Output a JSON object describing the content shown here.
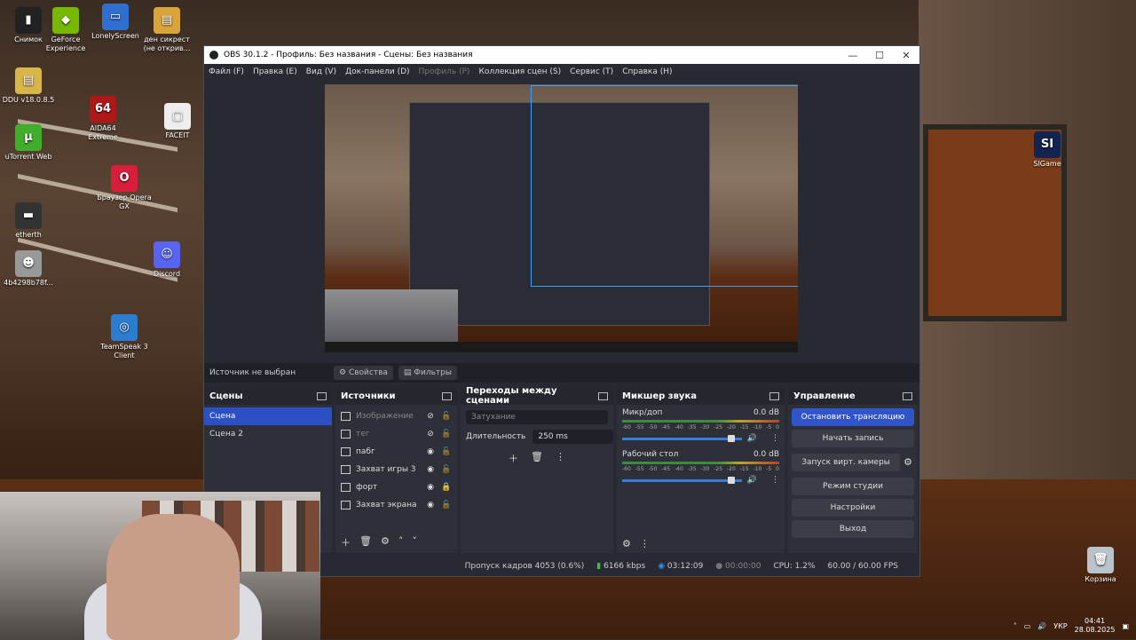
{
  "desktop": {
    "icons": [
      {
        "label": "Снимок",
        "glyph": "▮",
        "color": "#222"
      },
      {
        "label": "GeForce Experience",
        "glyph": "◆",
        "color": "#76b900"
      },
      {
        "label": "LonelyScreen",
        "glyph": "▭",
        "color": "#2f6fd0"
      },
      {
        "label": "ден сикрест (не открив...",
        "glyph": "▤",
        "color": "#d9a43a"
      },
      {
        "label": "DDU v18.0.8.5",
        "glyph": "▤",
        "color": "#d9b64a"
      },
      {
        "label": "AIDA64 Extreme",
        "glyph": "64",
        "color": "#b01818"
      },
      {
        "label": "FACEIT",
        "glyph": "▢",
        "color": "#eeeeee"
      },
      {
        "label": "uTorrent Web",
        "glyph": "µ",
        "color": "#3fae2a"
      },
      {
        "label": "Браузер Opera GX",
        "glyph": "O",
        "color": "#d81e3a"
      },
      {
        "label": "etherth",
        "glyph": "▬",
        "color": "#333"
      },
      {
        "label": "Discord",
        "glyph": "☺",
        "color": "#5865f2"
      },
      {
        "label": "4b4298b78f...",
        "glyph": "☻",
        "color": "#999"
      },
      {
        "label": "TeamSpeak 3 Client",
        "glyph": "◎",
        "color": "#2a7dd1"
      },
      {
        "label": "SIGame",
        "glyph": "SI",
        "color": "#12244f"
      },
      {
        "label": "Корзина",
        "glyph": "🗑",
        "color": "#b9c4cc"
      }
    ]
  },
  "window": {
    "title": "OBS 30.1.2 - Профиль: Без названия - Сцены: Без названия",
    "menu": [
      {
        "label": "Файл (F)",
        "dim": false
      },
      {
        "label": "Правка (E)",
        "dim": false
      },
      {
        "label": "Вид (V)",
        "dim": false
      },
      {
        "label": "Док-панели (D)",
        "dim": false
      },
      {
        "label": "Профиль (P)",
        "dim": true
      },
      {
        "label": "Коллекция сцен (S)",
        "dim": false
      },
      {
        "label": "Сервис (T)",
        "dim": false
      },
      {
        "label": "Справка (H)",
        "dim": false
      }
    ]
  },
  "source_bar": {
    "no_source": "Источник не выбран",
    "properties": "Свойства",
    "filters": "Фильтры"
  },
  "scenes": {
    "title": "Сцены",
    "items": [
      {
        "label": "Сцена",
        "active": true
      },
      {
        "label": "Сцена 2",
        "active": false
      }
    ]
  },
  "sources": {
    "title": "Источники",
    "items": [
      {
        "label": "Изображение",
        "visible": false,
        "locked": false
      },
      {
        "label": "тег",
        "visible": false,
        "locked": false
      },
      {
        "label": "пабг",
        "visible": true,
        "locked": false
      },
      {
        "label": "Захват игры 3",
        "visible": true,
        "locked": false
      },
      {
        "label": "форт",
        "visible": true,
        "locked": true
      },
      {
        "label": "Захват экрана",
        "visible": true,
        "locked": false
      }
    ]
  },
  "transitions": {
    "title": "Переходы между сценами",
    "type": "Затухание",
    "duration_label": "Длительность",
    "duration_value": "250 ms"
  },
  "mixer": {
    "title": "Микшер звука",
    "scale": [
      "-60",
      "-55",
      "-50",
      "-45",
      "-40",
      "-35",
      "-30",
      "-25",
      "-20",
      "-15",
      "-10",
      "-5",
      "0"
    ],
    "channels": [
      {
        "name": "Микр/доп",
        "db": "0.0 dB",
        "level": 0.88
      },
      {
        "name": "Рабочий стол",
        "db": "0.0 dB",
        "level": 0.88
      }
    ]
  },
  "controls": {
    "title": "Управление",
    "stop_stream": "Остановить трансляцию",
    "start_record": "Начать запись",
    "virtual_cam": "Запуск вирт. камеры",
    "studio_mode": "Режим студии",
    "settings": "Настройки",
    "exit": "Выход"
  },
  "status": {
    "dropped": "Пропуск кадров 4053 (0.6%)",
    "bitrate": "6166 kbps",
    "stream_time": "03:12:09",
    "record_time": "00:00:00",
    "cpu": "CPU: 1.2%",
    "fps": "60.00 / 60.00 FPS"
  },
  "tray": {
    "lang": "УКР",
    "time": "04:41",
    "date": "28.08.2025"
  },
  "colors": {
    "accent": "#2f55c8",
    "selection": "#3aa0ff"
  }
}
